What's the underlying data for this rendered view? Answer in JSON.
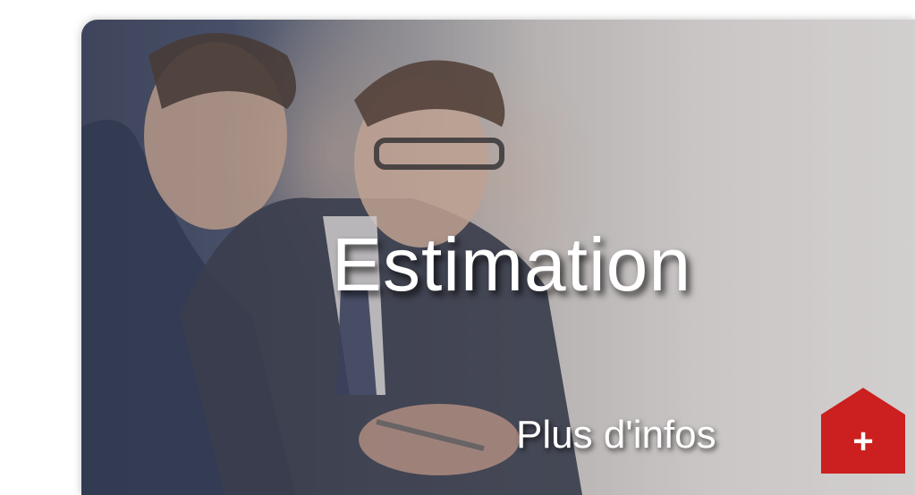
{
  "card": {
    "title": "Estimation",
    "more_label": "Plus d'infos",
    "more_button_symbol": "+",
    "more_button_icon": "house-plus-icon",
    "accent_color": "#cc1f1f"
  }
}
